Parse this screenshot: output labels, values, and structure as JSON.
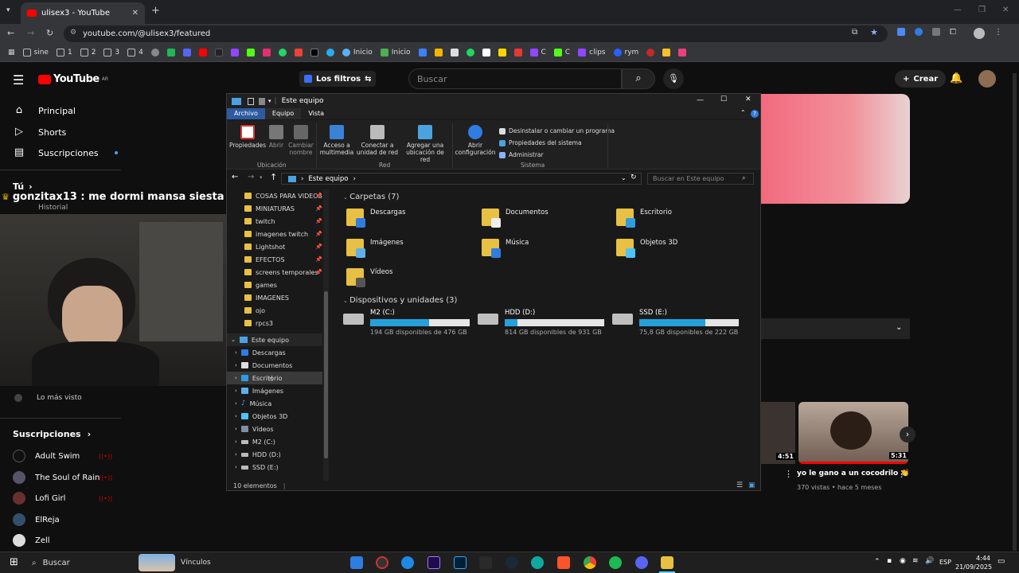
{
  "browser": {
    "tab_title": "ulisex3 - YouTube",
    "url": "youtube.com/@ulisex3/featured",
    "bookmarks": [
      "sine",
      "1",
      "2",
      "3",
      "4",
      "Inicio",
      "Inicio",
      "C",
      "C",
      "clips",
      "rym"
    ]
  },
  "youtube": {
    "logo": "YouTube",
    "logo_region": "AR",
    "filters_label": "Los filtros",
    "search_placeholder": "Buscar",
    "create_label": "Crear",
    "sidebar": {
      "items": [
        "Principal",
        "Shorts",
        "Suscripciones"
      ],
      "you_label": "Tú",
      "history": "Historial",
      "most_viewed": "Lo más visto",
      "subs_label": "Suscripciones",
      "subscriptions": [
        "Adult Swim",
        "The Soul of Rain",
        "Lofi Girl",
        "ElReja",
        "Zell"
      ]
    },
    "chat_overlay": "gonzitax13 : me dormi mansa siesta",
    "video": {
      "duration_a": "4:51",
      "duration_b": "5:31",
      "title": "yo le gano a un cocodrilo 👏",
      "meta": "370 vistas • hace 5 meses"
    }
  },
  "explorer": {
    "title": "Este equipo",
    "ribbon_tabs": [
      "Archivo",
      "Equipo",
      "Vista"
    ],
    "ribbon_buttons": {
      "props": "Propiedades",
      "open": "Abrir",
      "rename": "Cambiar nombre",
      "media": "Acceso a multimedia",
      "mapdrive": "Conectar a unidad de red",
      "addloc": "Agregar una ubicación de red",
      "settings": "Abrir configuración",
      "uninstall": "Desinstalar o cambiar un programa",
      "sysprops": "Propiedades del sistema",
      "manage": "Administrar"
    },
    "ribbon_groups": [
      "Ubicación",
      "Red",
      "Sistema"
    ],
    "path": "Este equipo",
    "search_placeholder": "Buscar en Este equipo",
    "tree": [
      "COSAS PARA VIDEOS",
      "MINIATURAS",
      "twitch",
      "imagenes twitch",
      "Lightshot",
      "EFECTOS",
      "screens temporales",
      "games",
      "IMAGENES",
      "ojo",
      "rpcs3"
    ],
    "tree_pc": "Este equipo",
    "tree_children": [
      "Descargas",
      "Documentos",
      "Escritorio",
      "Imágenes",
      "Música",
      "Objetos 3D",
      "Vídeos",
      "M2 (C:)",
      "HDD (D:)",
      "SSD (E:)"
    ],
    "folders_header": "Carpetas (7)",
    "folders": [
      "Descargas",
      "Documentos",
      "Escritorio",
      "Imágenes",
      "Música",
      "Objetos 3D",
      "Vídeos"
    ],
    "drives_header": "Dispositivos y unidades (3)",
    "drives": [
      {
        "name": "M2 (C:)",
        "free": "194 GB disponibles de 476 GB",
        "used": 0.59
      },
      {
        "name": "HDD (D:)",
        "free": "814 GB disponibles de 931 GB",
        "used": 0.13
      },
      {
        "name": "SSD (E:)",
        "free": "75,8 GB disponibles de 222 GB",
        "used": 0.66
      }
    ],
    "status": "10 elementos"
  },
  "taskbar": {
    "search": "Buscar",
    "links": "Vínculos",
    "lang": "ESP",
    "time": "4:44",
    "date": "21/09/2025"
  }
}
